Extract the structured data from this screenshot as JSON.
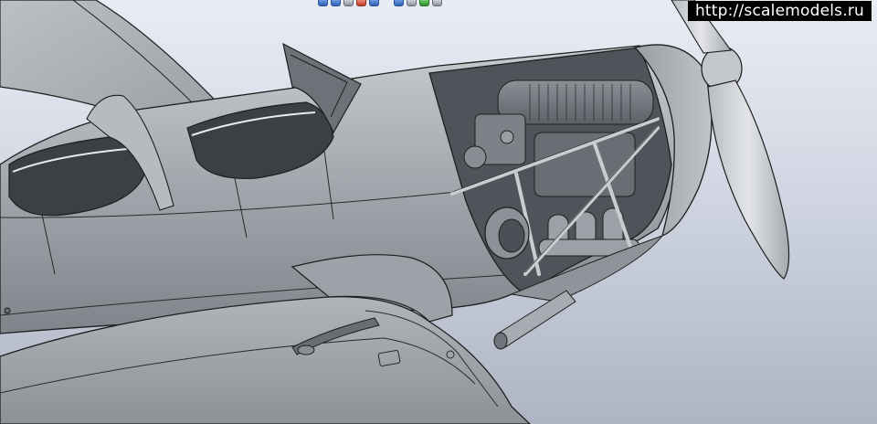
{
  "watermark": {
    "text": "http://scalemodels.ru"
  },
  "view_toolbar": {
    "buttons": [
      "zoom-fit",
      "zoom-area",
      "rotate",
      "pan",
      "view-orientation",
      "display-style",
      "section-view",
      "appearance",
      "settings"
    ]
  },
  "colors": {
    "background_top": "#e9ecf4",
    "background_bottom": "#aeb4c3",
    "model_surface": "#a4a8ae",
    "model_edge": "#1e1e1e",
    "watermark_bg": "#000000",
    "watermark_text": "#ffffff"
  }
}
